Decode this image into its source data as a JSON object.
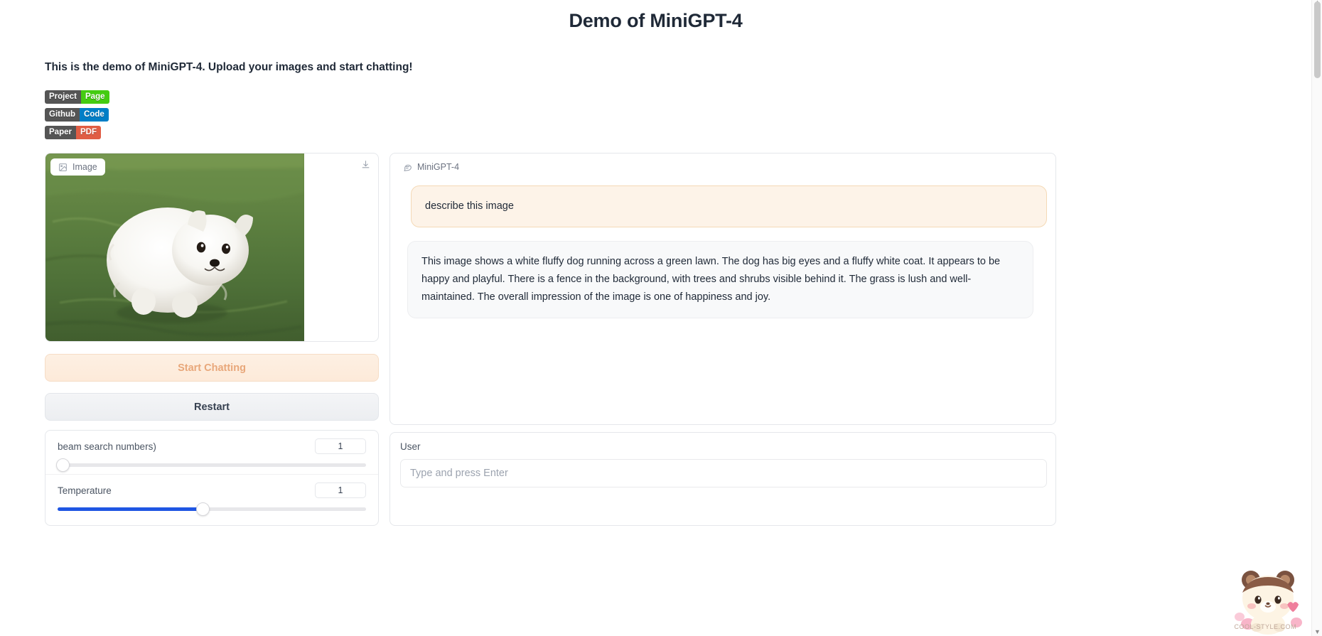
{
  "header": {
    "title": "Demo of MiniGPT-4",
    "intro": "This is the demo of MiniGPT-4. Upload your images and start chatting!"
  },
  "badges": [
    {
      "left": "Project",
      "right": "Page",
      "right_color": "#44cc11",
      "left_color": "#555555"
    },
    {
      "left": "Github",
      "right": "Code",
      "right_color": "#007ec6",
      "left_color": "#555555"
    },
    {
      "left": "Paper",
      "right": "PDF",
      "right_color": "#e05d44",
      "left_color": "#555555"
    }
  ],
  "image_panel": {
    "tab_label": "Image",
    "tab_icon": "image-icon",
    "download_icon": "download-icon"
  },
  "buttons": {
    "start_chatting": "Start Chatting",
    "restart": "Restart"
  },
  "sliders": [
    {
      "label": "beam search numbers)",
      "value": "1",
      "fill_percent": 0
    },
    {
      "label": "Temperature",
      "value": "1",
      "fill_percent": 47
    }
  ],
  "chat_panel": {
    "tab_label": "MiniGPT-4",
    "tab_icon": "chat-bubble-icon",
    "messages": [
      {
        "role": "user",
        "text": "describe this image"
      },
      {
        "role": "bot",
        "text": "This image shows a white fluffy dog running across a green lawn. The dog has big eyes and a fluffy white coat. It appears to be happy and playful. There is a fence in the background, with trees and shrubs visible behind it. The grass is lush and well-maintained. The overall impression of the image is one of happiness and joy."
      }
    ]
  },
  "input_panel": {
    "label": "User",
    "placeholder": "Type and press Enter",
    "value": ""
  },
  "mascot": {
    "caption": "COOL-STYLE.COM"
  },
  "colors": {
    "accent_blue": "#1f56e3",
    "user_bubble": "#fdf3e8",
    "bot_bubble": "#f8f9fa",
    "start_btn_text": "#e8a77a"
  }
}
